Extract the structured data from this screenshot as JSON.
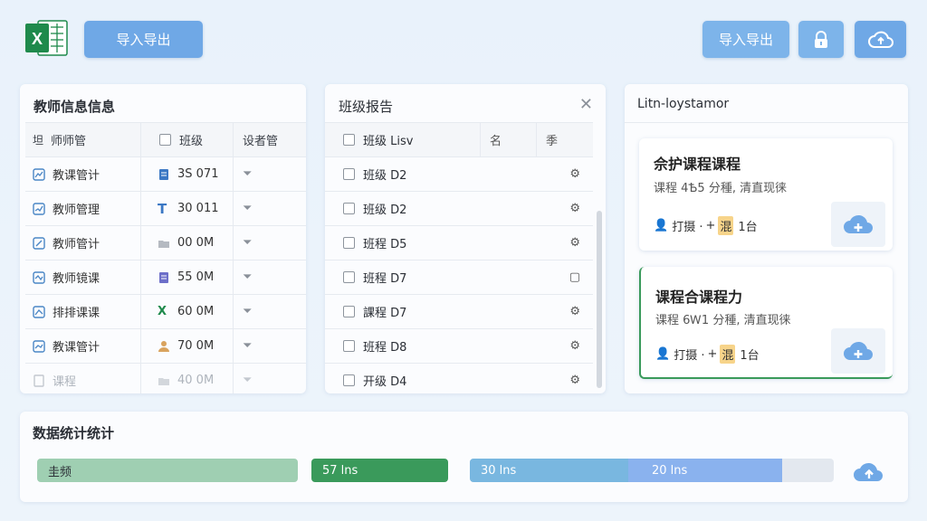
{
  "toolbar": {
    "import_export_label": "导入导出",
    "import_export_label_2": "导入导出"
  },
  "teacher_panel": {
    "title": "教师信息信息",
    "columns": [
      "师师管",
      "班级",
      "设者管"
    ],
    "rows": [
      {
        "name": "教课管计",
        "value": "3S 071"
      },
      {
        "name": "教师管理",
        "value": "30 011"
      },
      {
        "name": "教师管计",
        "value": "00 0M"
      },
      {
        "name": "教师镜课",
        "value": "55 0M"
      },
      {
        "name": "排排课课",
        "value": "60 0M"
      },
      {
        "name": "教课管计",
        "value": "70 0M"
      },
      {
        "name": "课程",
        "value": "40 0M"
      }
    ]
  },
  "class_panel": {
    "title": "班级报告",
    "columns": [
      "班级 Lisv",
      "名",
      "季"
    ],
    "rows": [
      "班级 D2",
      "班级 D2",
      "班程 D5",
      "班程 D7",
      "課程 D7",
      "班程 D8",
      "开级 D4"
    ]
  },
  "course_panel": {
    "title": "Litn-loystamor",
    "items": [
      {
        "title": "佘护课程课程",
        "subtitle": "课程 4Ѣ5 分種, 清直现徕",
        "meta_a": "打摄 ·",
        "meta_tag": "混",
        "meta_b": "1台"
      },
      {
        "title": "课程合课程力",
        "subtitle": "课程 6Ꮃ1 分種, 清直现徕",
        "meta_a": "打摄 ·",
        "meta_tag": "混",
        "meta_b": "1台"
      }
    ]
  },
  "stats": {
    "title": "数据统计统计",
    "bars": [
      {
        "label": "圭频",
        "color": "#9fcfb2"
      },
      {
        "label": "57 lns",
        "color": "#3a9a5b"
      },
      {
        "label": "30 lns",
        "color": "#79b7e0"
      },
      {
        "label": "20 lns",
        "color": "#8ab2ee"
      }
    ]
  },
  "colors": {
    "primary": "#6fa8e6",
    "excel_green": "#1f8a4c",
    "accent_green": "#3a9a5b"
  }
}
